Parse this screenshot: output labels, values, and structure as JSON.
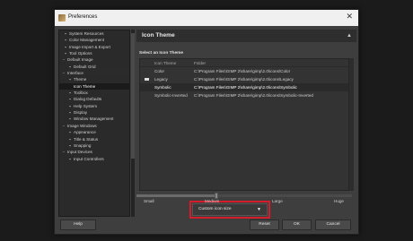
{
  "window": {
    "title": "Preferences",
    "close_glyph": "✕"
  },
  "sidebar": {
    "items": [
      {
        "label": "System Resources",
        "marker": "▪",
        "indent": 1
      },
      {
        "label": "Color Management",
        "marker": "▪",
        "indent": 1
      },
      {
        "label": "Image Import & Export",
        "marker": "▪",
        "indent": 1
      },
      {
        "label": "Tool Options",
        "marker": "▪",
        "indent": 1
      },
      {
        "label": "Default Image",
        "marker": "−",
        "indent": 0
      },
      {
        "label": "Default Grid",
        "marker": "▪",
        "indent": 2
      },
      {
        "label": "Interface",
        "marker": "−",
        "indent": 0,
        "state": "selected"
      },
      {
        "label": "Theme",
        "marker": "▪",
        "indent": 2
      },
      {
        "label": "Icon Theme",
        "marker": "",
        "indent": 2,
        "state": "active"
      },
      {
        "label": "Toolbox",
        "marker": "▪",
        "indent": 2
      },
      {
        "label": "Dialog Defaults",
        "marker": "▪",
        "indent": 2
      },
      {
        "label": "Help System",
        "marker": "▪",
        "indent": 2
      },
      {
        "label": "Display",
        "marker": "▪",
        "indent": 2
      },
      {
        "label": "Window Management",
        "marker": "▪",
        "indent": 2
      },
      {
        "label": "Image Windows",
        "marker": "−",
        "indent": 0
      },
      {
        "label": "Appearance",
        "marker": "▪",
        "indent": 2
      },
      {
        "label": "Title & Status",
        "marker": "▪",
        "indent": 2
      },
      {
        "label": "Snapping",
        "marker": "▪",
        "indent": 2
      },
      {
        "label": "Input Devices",
        "marker": "−",
        "indent": 0
      },
      {
        "label": "Input Controllers",
        "marker": "▪",
        "indent": 2
      }
    ]
  },
  "main": {
    "header": "Icon Theme",
    "header_arrow": "▲",
    "section_title": "Select an Icon Theme",
    "columns": [
      "Icon Theme",
      "Folder"
    ],
    "themes": [
      {
        "name": "Color",
        "folder": "C:\\Program Files\\GIMP 2\\share\\gimp\\2.0\\icons\\Color"
      },
      {
        "name": "Legacy",
        "folder": "C:\\Program Files\\GIMP 2\\share\\gimp\\2.0\\icons\\Legacy",
        "icon": true
      },
      {
        "name": "Symbolic",
        "folder": "C:\\Program Files\\GIMP 2\\share\\gimp\\2.0\\icons\\Symbolic",
        "selected": true
      },
      {
        "name": "Symbolic-Inverted",
        "folder": "C:\\Program Files\\GIMP 2\\share\\gimp\\2.0\\icons\\Symbolic-Inverted"
      }
    ],
    "size_dropdown": {
      "value": "Custom icon size",
      "chevron": "▼"
    },
    "size_labels": [
      "Small",
      "Medium",
      "Large",
      "Huge"
    ],
    "size_slider_position": 0.37,
    "highlight_color": "#d41c2a"
  },
  "buttons": {
    "help": "Help",
    "reset": "Reset",
    "ok": "OK",
    "cancel": "Cancel"
  }
}
